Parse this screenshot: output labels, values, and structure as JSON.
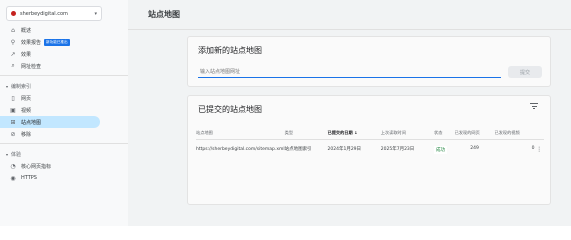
{
  "property": {
    "name": "sherbeydigital.com"
  },
  "sidebar": {
    "items": [
      {
        "label": "概述",
        "icon": "home-icon"
      },
      {
        "label": "效果报告",
        "icon": "search-perf-icon",
        "badge": "新功能已推出"
      },
      {
        "label": "效果",
        "icon": "trend-icon"
      },
      {
        "label": "网址检查",
        "icon": "search-icon"
      }
    ],
    "index_section": "编制索引",
    "index_items": [
      {
        "label": "网页",
        "icon": "page-icon"
      },
      {
        "label": "视频",
        "icon": "video-icon"
      },
      {
        "label": "站点地图",
        "icon": "sitemap-icon"
      },
      {
        "label": "移除",
        "icon": "remove-icon"
      }
    ],
    "experience_section": "体验",
    "experience_items": [
      {
        "label": "核心网页指标",
        "icon": "gauge-icon"
      },
      {
        "label": "HTTPS",
        "icon": "lock-icon"
      }
    ]
  },
  "header": {
    "title": "站点地图"
  },
  "add_card": {
    "title": "添加新的站点地图",
    "input_placeholder": "输入站点地图网址",
    "submit_label": "提交"
  },
  "submitted_card": {
    "title": "已提交的站点地图",
    "columns": [
      "站点地图",
      "类型",
      "已提交的日期",
      "上次读取时间",
      "状态",
      "已发现的网页",
      "已发现的视频"
    ],
    "sort_arrow": "↓",
    "rows": [
      {
        "sitemap": "https://sherbeydigital.com/sitemap.xml",
        "type": "站点地图索引",
        "submitted": "2024年1月29日",
        "last_read": "2025年7月23日",
        "status": "成功",
        "pages": "249",
        "videos": "0"
      }
    ]
  },
  "colors": {
    "accent": "#1a73e8",
    "success": "#188038",
    "active_bg": "#c2e7ff"
  }
}
